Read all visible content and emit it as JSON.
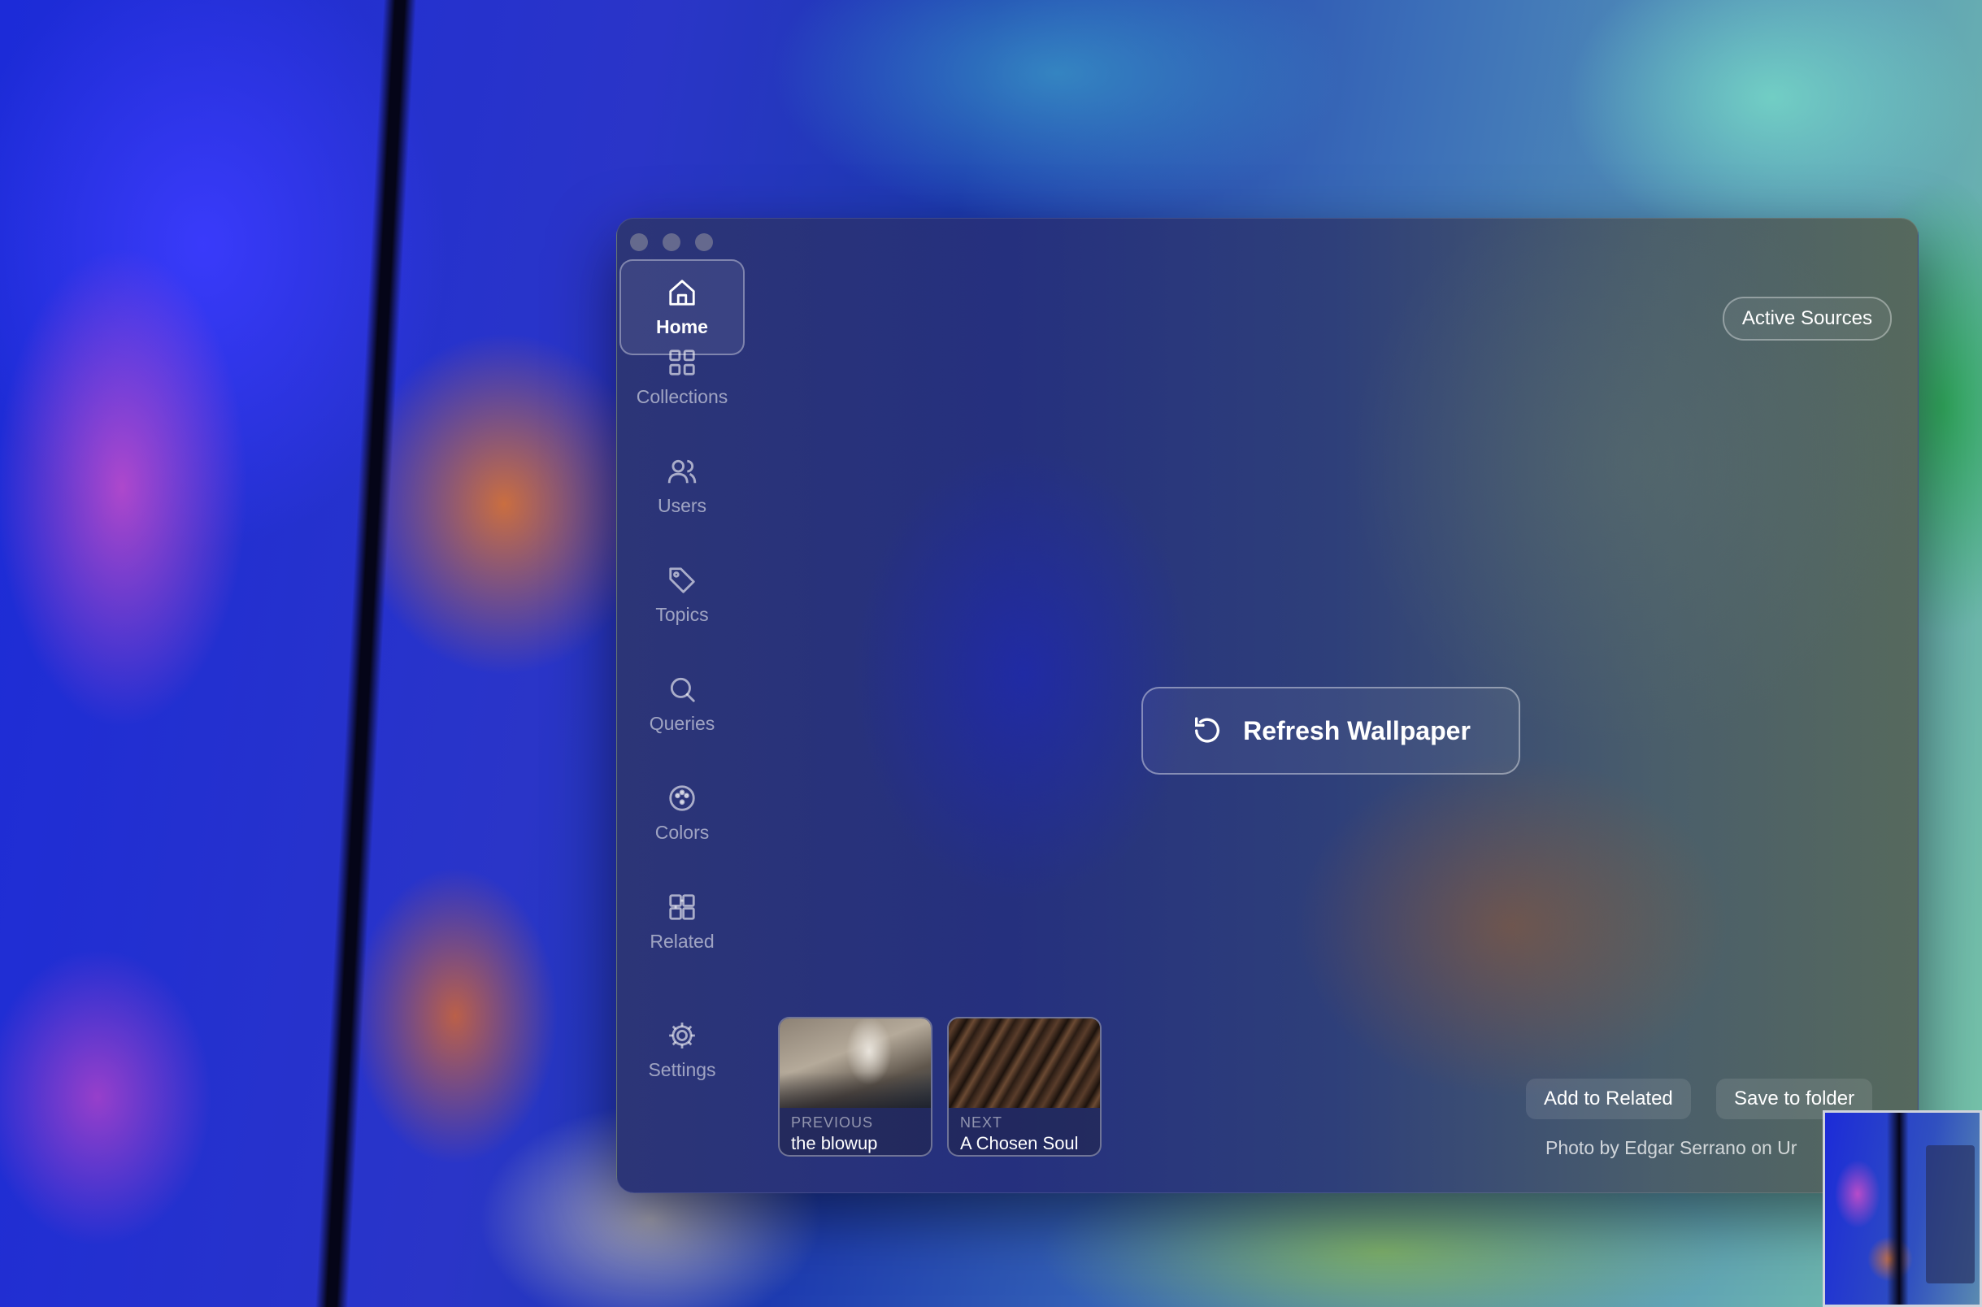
{
  "sidebar": {
    "items": [
      {
        "label": "Home",
        "icon": "home-icon",
        "active": true
      },
      {
        "label": "Collections",
        "icon": "grid-icon"
      },
      {
        "label": "Users",
        "icon": "users-icon"
      },
      {
        "label": "Topics",
        "icon": "tag-icon"
      },
      {
        "label": "Queries",
        "icon": "search-icon"
      },
      {
        "label": "Colors",
        "icon": "palette-icon"
      },
      {
        "label": "Related",
        "icon": "related-icon"
      },
      {
        "label": "Settings",
        "icon": "gear-icon"
      }
    ]
  },
  "header": {
    "active_sources_label": "Active Sources"
  },
  "main": {
    "refresh_label": "Refresh Wallpaper"
  },
  "history": {
    "previous": {
      "caption": "PREVIOUS",
      "title": "the blowup"
    },
    "next": {
      "caption": "NEXT",
      "title": "A Chosen Soul"
    }
  },
  "actions": {
    "add_related_label": "Add to Related",
    "save_folder_label": "Save to folder"
  },
  "credit": "Photo by Edgar Serrano on Ur"
}
